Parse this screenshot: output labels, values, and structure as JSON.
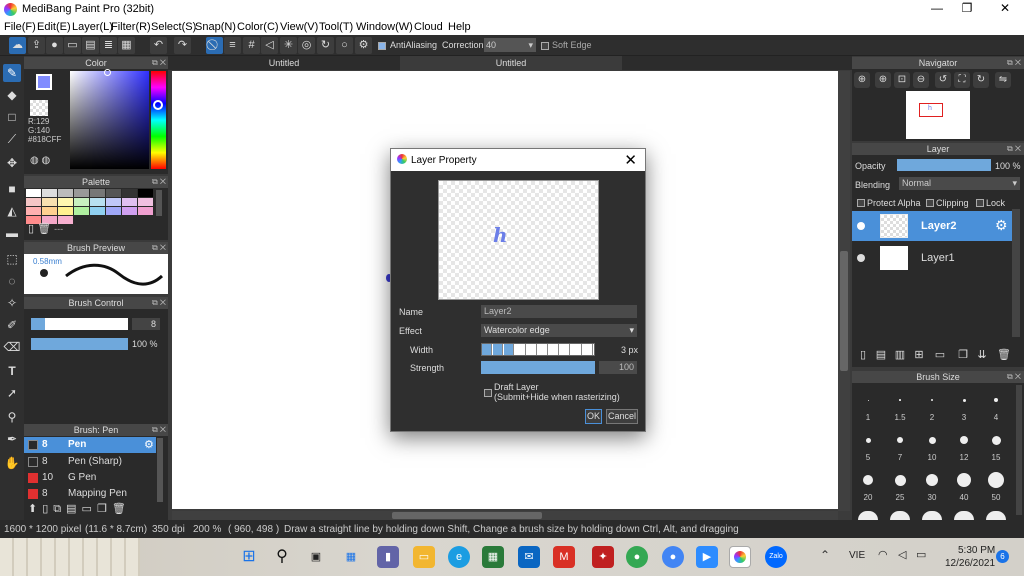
{
  "window": {
    "title": "MediBang Paint Pro (32bit)",
    "minimize": "—",
    "maximize": "❐",
    "close": "✕"
  },
  "menu": [
    "File(F)",
    "Edit(E)",
    "Layer(L)",
    "Filter(R)",
    "Select(S)",
    "Snap(N)",
    "Color(C)",
    "View(V)",
    "Tool(T)",
    "Window(W)",
    "Cloud",
    "Help"
  ],
  "toolbar": {
    "antialiasing_label": "AntiAliasing",
    "correction_label": "Correction",
    "correction_value": "40",
    "soft_edge_label": "Soft Edge",
    "icons": [
      "cloud-icon",
      "share-icon",
      "comment-icon",
      "message-icon",
      "document-icon",
      "list-icon",
      "grid-icon",
      "undo-icon",
      "redo-icon",
      "snap-off-icon",
      "parallel-snap-icon",
      "grid-snap-icon",
      "vanishing-point-icon",
      "radial-snap-icon",
      "concentric-snap-icon",
      "curve-snap-icon",
      "circle-snap-icon",
      "snap-settings-icon"
    ]
  },
  "tools": [
    "brush-icon",
    "eraser-icon",
    "rectangle-icon",
    "line-icon",
    "move-icon",
    "fill-rect-icon",
    "bucket-icon",
    "gradient-icon",
    "select-rect-icon",
    "lasso-icon",
    "magic-wand-icon",
    "select-pen-icon",
    "select-eraser-icon",
    "text-icon",
    "operation-icon",
    "dropper-icon",
    "hand-icon"
  ],
  "color_panel": {
    "title": "Color",
    "r": "R:129",
    "g": "G:140",
    "b": "B:255",
    "hex": "#818CFF",
    "current_color": "#818CFF"
  },
  "palette_panel": {
    "title": "Palette",
    "note": "---"
  },
  "brush_preview_panel": {
    "title": "Brush Preview",
    "size": "0.58mm"
  },
  "brush_control_panel": {
    "title": "Brush Control",
    "size_value": "8",
    "opacity_value": "100 %"
  },
  "brush_panel": {
    "title": "Brush: Pen",
    "items": [
      {
        "size": "8",
        "name": "Pen",
        "color": "#2a2a2a",
        "selected": true
      },
      {
        "size": "8",
        "name": "Pen (Sharp)",
        "color": "#2a2a2a",
        "selected": false
      },
      {
        "size": "10",
        "name": "G Pen",
        "color": "#e03030",
        "selected": false
      },
      {
        "size": "8",
        "name": "Mapping Pen",
        "color": "#e03030",
        "selected": false
      }
    ]
  },
  "tabs": [
    "Untitled",
    "Untitled"
  ],
  "dialog": {
    "title": "Layer Property",
    "preview_glyph": "h",
    "name_label": "Name",
    "name_value": "Layer2",
    "effect_label": "Effect",
    "effect_value": "Watercolor edge",
    "width_label": "Width",
    "width_value": "3 px",
    "width_fraction": 0.3,
    "strength_label": "Strength",
    "strength_value": "100",
    "draft_label": "Draft Layer",
    "draft_sublabel": "(Submit+Hide when rasterizing)",
    "ok": "OK",
    "cancel": "Cancel"
  },
  "navigator": {
    "title": "Navigator"
  },
  "layer_panel": {
    "title": "Layer",
    "opacity_label": "Opacity",
    "opacity_value": "100 %",
    "blending_label": "Blending",
    "blending_value": "Normal",
    "protect_alpha": "Protect Alpha",
    "clipping": "Clipping",
    "lock": "Lock",
    "layers": [
      {
        "name": "Layer2",
        "selected": true
      },
      {
        "name": "Layer1",
        "selected": false
      }
    ]
  },
  "brush_size_panel": {
    "title": "Brush Size",
    "row1": [
      "1",
      "1.5",
      "2",
      "3",
      "4"
    ],
    "row2": [
      "5",
      "7",
      "10",
      "12",
      "15"
    ],
    "row3": [
      "20",
      "25",
      "30",
      "40",
      "50"
    ]
  },
  "status": {
    "canvas_size": "1600 * 1200 pixel",
    "physical_size": "(11.6 * 8.7cm)",
    "dpi": "350 dpi",
    "zoom": "200 %",
    "coords": "( 960, 498 )",
    "hint": "Draw a straight line by holding down Shift, Change a brush size by holding down Ctrl, Alt, and dragging"
  },
  "taskbar": {
    "tray_text": "VIE",
    "time": "5:30 PM",
    "date": "12/26/2021",
    "notifications": "6",
    "zalo": "Zalo"
  }
}
